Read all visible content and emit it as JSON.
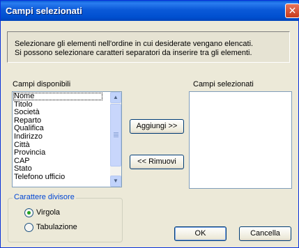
{
  "window": {
    "title": "Campi selezionati",
    "close_glyph": "✕"
  },
  "info": {
    "line1": "Selezionare gli elementi nell'ordine in cui desiderate vengano elencati.",
    "line2": "Si possono selezionare caratteri separatori da inserire tra gli elementi."
  },
  "available": {
    "label": "Campi disponibili",
    "items": [
      "Nome",
      "Titolo",
      "Società",
      "Reparto",
      "Qualifica",
      "Indirizzo",
      "Città",
      "Provincia",
      "CAP",
      "Stato",
      "Telefono ufficio"
    ],
    "focused_item": "Nome"
  },
  "selected": {
    "label": "Campi selezionati",
    "items": []
  },
  "buttons": {
    "add": "Aggiungi >>",
    "remove": "<< Rimuovi",
    "ok": "OK",
    "cancel": "Cancella"
  },
  "divider": {
    "label": "Carattere divisore",
    "options": [
      {
        "label": "Virgola",
        "checked": true
      },
      {
        "label": "Tabulazione",
        "checked": false
      }
    ]
  },
  "icons": {
    "scroll_up": "▲",
    "scroll_down": "▼"
  },
  "colors": {
    "title_bar": "#0a5bd6",
    "dialog_bg": "#ece9d8",
    "group_label": "#0046d5",
    "radio_selected": "#21a121"
  }
}
